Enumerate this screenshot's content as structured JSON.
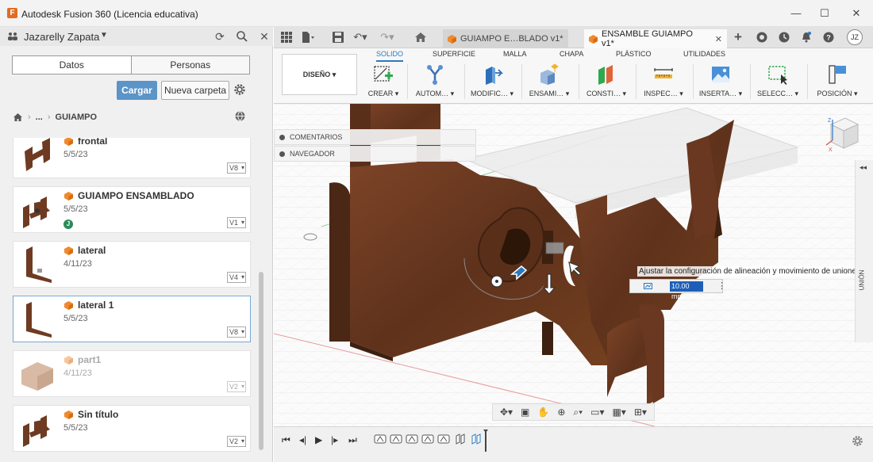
{
  "window": {
    "title": "Autodesk Fusion 360 (Licencia educativa)",
    "logo_letter": "F",
    "minimize": "—",
    "maximize": "☐",
    "close": "✕"
  },
  "left_panel": {
    "user": "Jazarelly Zapata",
    "tabs": [
      "Datos",
      "Personas"
    ],
    "upload_label": "Cargar",
    "new_folder_label": "Nueva carpeta",
    "breadcrumb": [
      "...",
      "GUIAMPO"
    ],
    "items": [
      {
        "name": "frontal",
        "date": "5/5/23",
        "version": "V8"
      },
      {
        "name": "GUIAMPO ENSAMBLADO",
        "date": "5/5/23",
        "version": "V1",
        "badge": "J"
      },
      {
        "name": "lateral",
        "date": "4/11/23",
        "version": "V4"
      },
      {
        "name": "lateral 1",
        "date": "5/5/23",
        "version": "V8"
      },
      {
        "name": "part1",
        "date": "4/11/23",
        "version": "V2"
      },
      {
        "name": "Sin título",
        "date": "5/5/23",
        "version": "V2"
      }
    ]
  },
  "doc_tabs": [
    {
      "label": "GUIAMPO E…BLADO v1*"
    },
    {
      "label": "ENSAMBLE GUIAMPO v1*"
    }
  ],
  "user_initials": "JZ",
  "ribbon": {
    "workspace": "DISEÑO",
    "tabs": [
      "SOLIDO",
      "SUPERFICIE",
      "MALLA",
      "CHAPA",
      "PLÁSTICO",
      "UTILIDADES"
    ],
    "groups": [
      "CREAR",
      "AUTOM…",
      "MODIFIC…",
      "ENSAMI…",
      "CONSTI…",
      "INSPEC…",
      "INSERTA…",
      "SELECC…",
      "POSICIÓN"
    ]
  },
  "viewport": {
    "panels": [
      "COMENTARIOS",
      "NAVEGADOR"
    ],
    "tooltip": "Ajustar la configuración de alineación y movimiento de uniones",
    "dimension_value": "10.00 mm",
    "side_panel_label": "UNIÓN",
    "viewcube_axes": [
      "Z",
      "X"
    ]
  },
  "colors": {
    "accent": "#2b78c2",
    "wood": "#6e3b22",
    "primary_button": "#5b94c8"
  }
}
